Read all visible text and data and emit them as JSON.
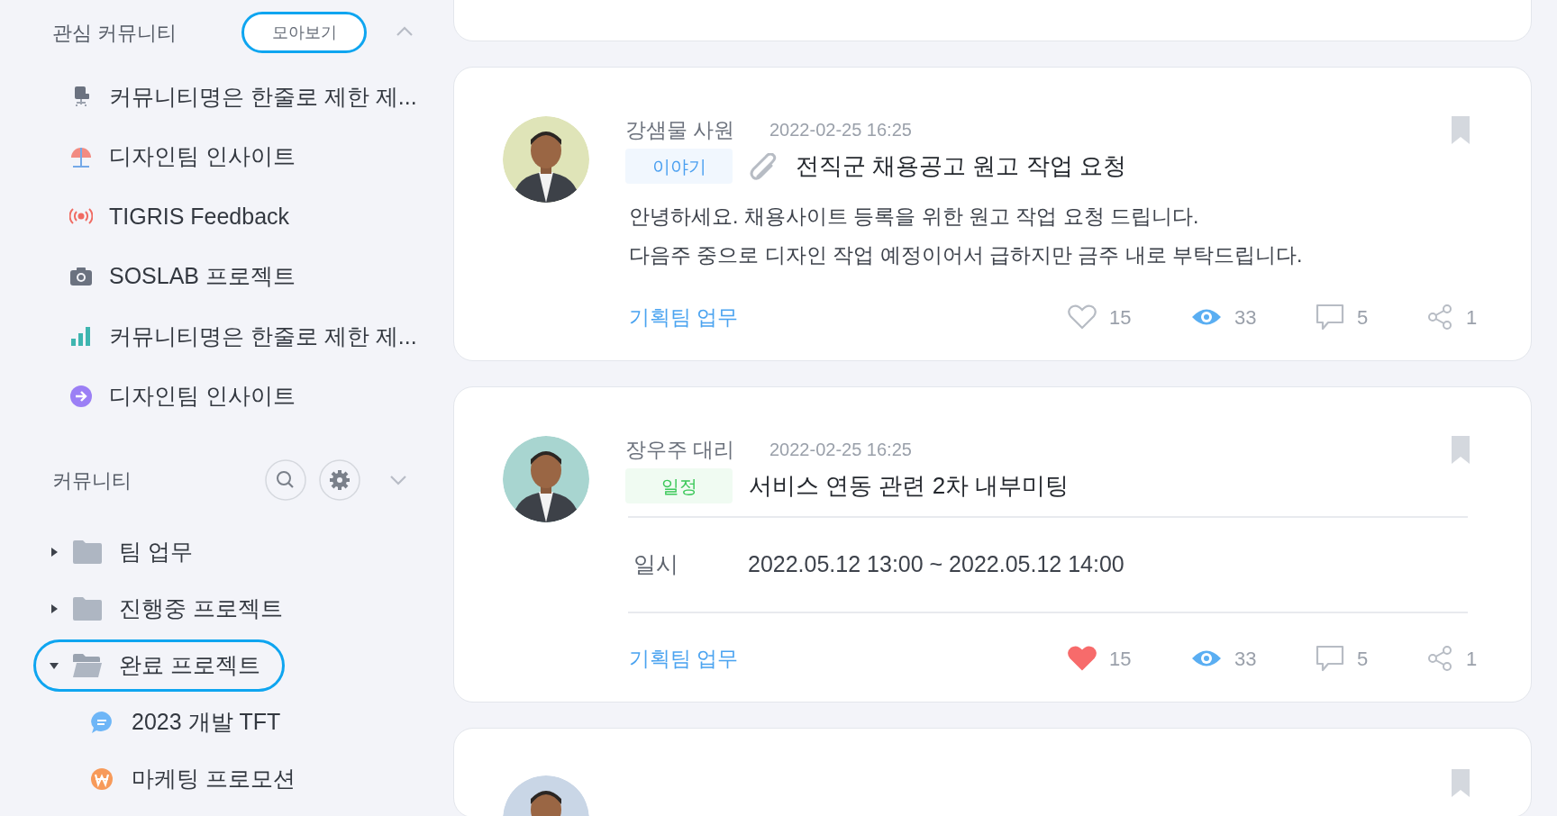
{
  "sidebar": {
    "favorites": {
      "title": "관심 커뮤니티",
      "view_all_button": "모아보기",
      "expanded": true,
      "items": [
        {
          "kind": "chair",
          "label": "커뮤니티명은 한줄로 제한 제..."
        },
        {
          "kind": "umbrella",
          "label": "디자인팀 인사이트"
        },
        {
          "kind": "broadcast",
          "label": "TIGRIS Feedback"
        },
        {
          "kind": "camera",
          "label": "SOSLAB 프로젝트"
        },
        {
          "kind": "bars",
          "label": "커뮤니티명은 한줄로 제한 제..."
        },
        {
          "kind": "arrow",
          "label": "디자인팀 인사이트"
        }
      ]
    },
    "communities": {
      "title": "커뮤니티",
      "expanded": false,
      "tree": [
        {
          "label": "팀 업무",
          "expanded": false,
          "selected": false
        },
        {
          "label": "진행중 프로젝트",
          "expanded": false,
          "selected": false
        },
        {
          "label": "완료 프로젝트",
          "expanded": true,
          "selected": true,
          "children": [
            {
              "kind": "chat",
              "label": "2023 개발 TFT"
            },
            {
              "kind": "coin",
              "label": "마케팅 프로모션"
            }
          ]
        }
      ]
    }
  },
  "posts": [
    {
      "kind": "partial_bottom"
    },
    {
      "kind": "text",
      "author": "강샘물 사원",
      "date": "2022-02-25 16:25",
      "tag": {
        "label": "이야기",
        "color": "#4a9ff0"
      },
      "has_attachment": true,
      "title": "전직군 채용공고 원고 작업 요청",
      "body": [
        "안녕하세요. 채용사이트 등록을 위한 원고 작업 요청 드립니다.",
        "다음주 중으로 디자인 작업 예정이어서 급하지만 금주 내로 부탁드립니다."
      ],
      "community": "기획팀 업무",
      "liked": false,
      "likes": "15",
      "views": "33",
      "comments": "5",
      "shares": "1"
    },
    {
      "kind": "schedule",
      "author": "장우주 대리",
      "date": "2022-02-25 16:25",
      "tag": {
        "label": "일정",
        "color": "#3cc85a"
      },
      "has_attachment": false,
      "title": "서비스 연동 관련 2차 내부미팅",
      "schedule": {
        "label": "일시",
        "value": "2022.05.12 13:00 ~ 2022.05.12 14:00"
      },
      "community": "기획팀 업무",
      "liked": true,
      "likes": "15",
      "views": "33",
      "comments": "5",
      "shares": "1"
    },
    {
      "kind": "partial_top"
    }
  ]
}
